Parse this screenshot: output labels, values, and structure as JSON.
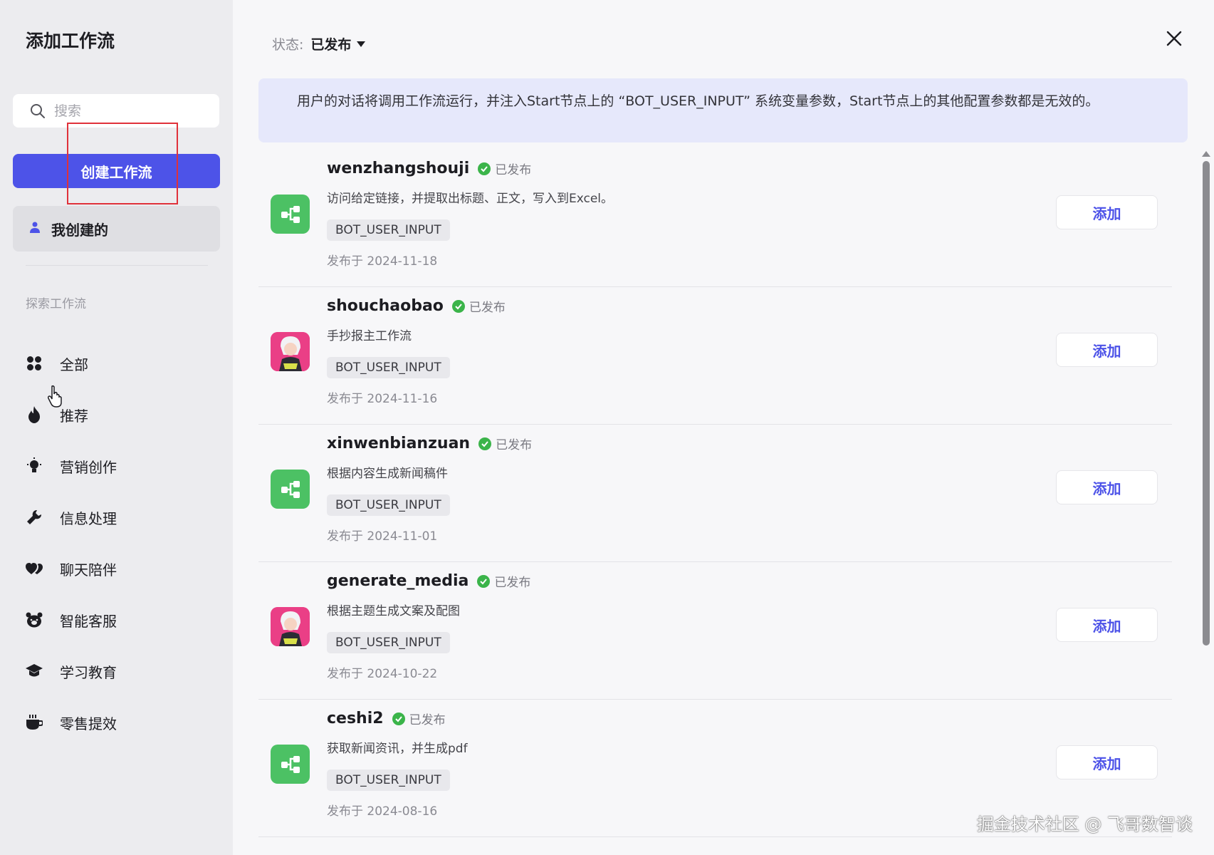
{
  "sidebar": {
    "title": "添加工作流",
    "search_placeholder": "搜索",
    "create_button": "创建工作流",
    "my_created": "我创建的",
    "explore_title": "探索工作流",
    "categories": [
      {
        "label": "全部",
        "icon": "grid-icon"
      },
      {
        "label": "推荐",
        "icon": "fire-icon"
      },
      {
        "label": "营销创作",
        "icon": "bulb-icon"
      },
      {
        "label": "信息处理",
        "icon": "wrench-icon"
      },
      {
        "label": "聊天陪伴",
        "icon": "hearts-icon"
      },
      {
        "label": "智能客服",
        "icon": "bear-icon"
      },
      {
        "label": "学习教育",
        "icon": "graduation-cap-icon"
      },
      {
        "label": "零售提效",
        "icon": "cup-icon"
      }
    ]
  },
  "header": {
    "status_label": "状态:",
    "status_value": "已发布"
  },
  "notice": "用户的对话将调用工作流运行，并注入Start节点上的 “BOT_USER_INPUT” 系统变量参数，Start节点上的其他配置参数都是无效的。",
  "workflows": [
    {
      "name": "wenzhangshouji",
      "status": "已发布",
      "desc": "访问给定链接，并提取出标题、正文，写入到Excel。",
      "tag": "BOT_USER_INPUT",
      "date": "发布于 2024-11-18",
      "avatar": "green",
      "add": "添加"
    },
    {
      "name": "shouchaobao",
      "status": "已发布",
      "desc": "手抄报主工作流",
      "tag": "BOT_USER_INPUT",
      "date": "发布于 2024-11-16",
      "avatar": "pink",
      "add": "添加"
    },
    {
      "name": "xinwenbianzuan",
      "status": "已发布",
      "desc": "根据内容生成新闻稿件",
      "tag": "BOT_USER_INPUT",
      "date": "发布于 2024-11-01",
      "avatar": "green",
      "add": "添加"
    },
    {
      "name": "generate_media",
      "status": "已发布",
      "desc": "根据主题生成文案及配图",
      "tag": "BOT_USER_INPUT",
      "date": "发布于 2024-10-22",
      "avatar": "pink",
      "add": "添加"
    },
    {
      "name": "ceshi2",
      "status": "已发布",
      "desc": "获取新闻资讯，并生成pdf",
      "tag": "BOT_USER_INPUT",
      "date": "发布于 2024-08-16",
      "avatar": "green",
      "add": "添加"
    }
  ],
  "watermark": "掘金技术社区 @ 飞哥数智谈",
  "colors": {
    "accent": "#4d53e8",
    "sidebar_bg": "#ececef",
    "notice_bg": "#e6e8fb",
    "published_green": "#3bb44a",
    "highlight": "#e0313a"
  }
}
